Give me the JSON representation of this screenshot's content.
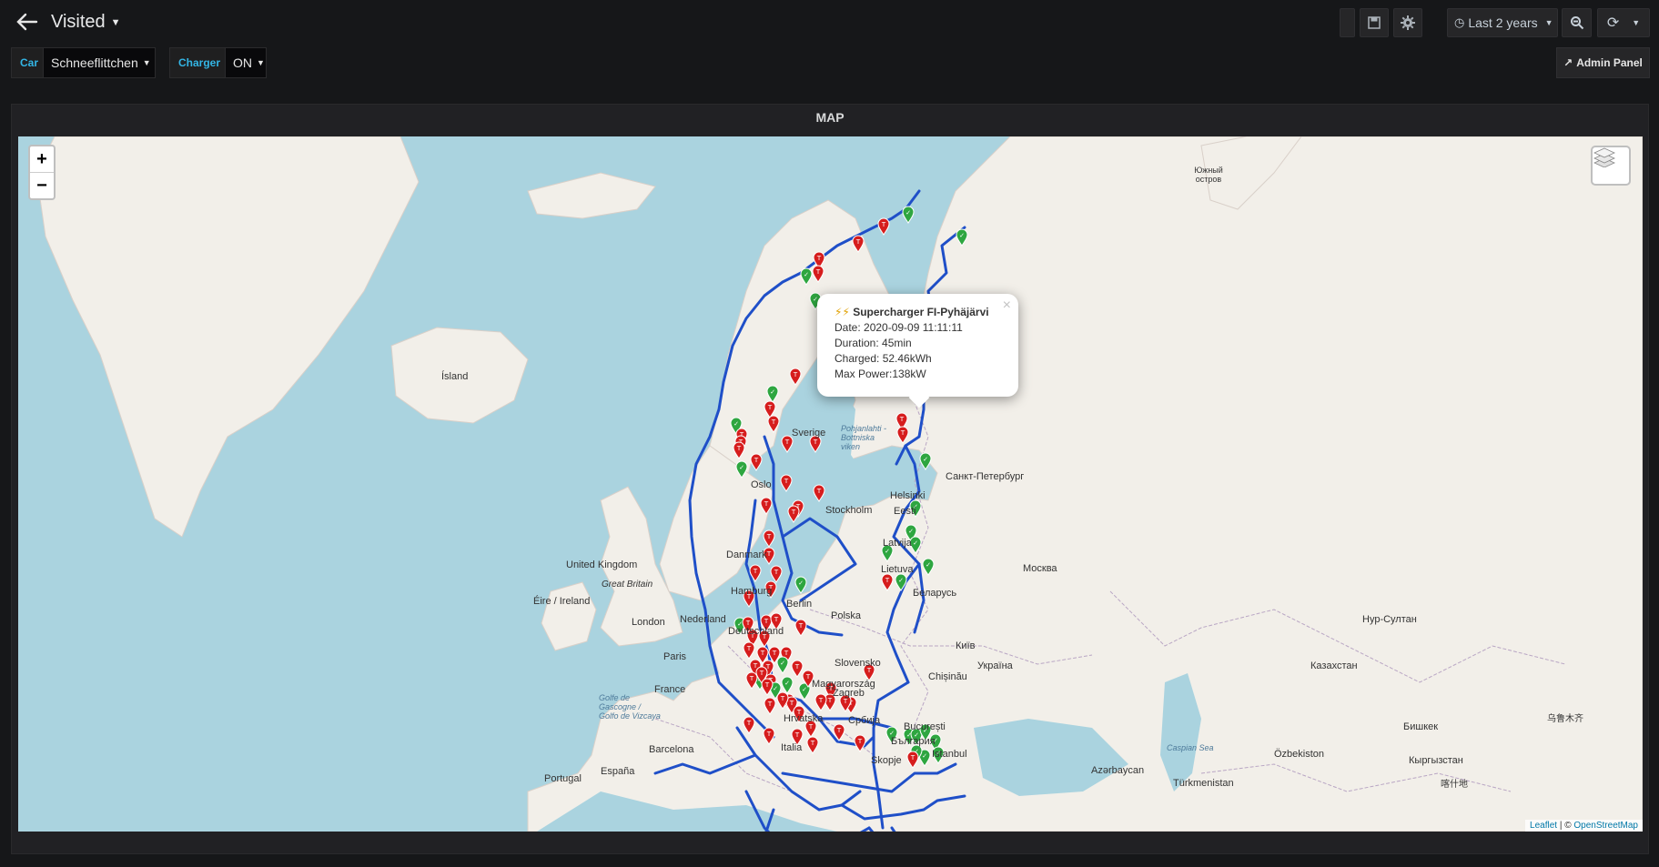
{
  "header": {
    "title": "Visited",
    "time_range": "Last 2 years"
  },
  "variables": [
    {
      "label": "Car",
      "value": "Schneeflittchen"
    },
    {
      "label": "Charger",
      "value": "ON"
    }
  ],
  "admin_panel_label": "Admin Panel",
  "panel": {
    "title": "MAP"
  },
  "map": {
    "zoom_in": "+",
    "zoom_out": "−",
    "popup": {
      "icon": "⚡⚡",
      "title": "Supercharger FI-Pyhäjärvi",
      "date": "Date: 2020-09-09 11:11:11",
      "duration": "Duration: 45min",
      "charged": "Charged: 52.46kWh",
      "max_power": "Max Power:138kW",
      "close": "×"
    },
    "attribution": {
      "leaflet": "Leaflet",
      "separator": " | © ",
      "osm": "OpenStreetMap"
    },
    "place_labels": [
      "Ísland",
      "United Kingdom",
      "Great Britain",
      "Éire / Ireland",
      "London",
      "Nederland",
      "Paris",
      "France",
      "Sverige",
      "Oslo",
      "Stockholm",
      "Danmark",
      "Hamburg",
      "Berlin",
      "Polska",
      "Latvija",
      "Lietuva",
      "Беларусь",
      "Helsinki",
      "Eesti",
      "Санкт-Петербург",
      "Москва",
      "Україна",
      "Київ",
      "Chișinău",
      "Magyarország",
      "Slovensko",
      "Hrvatska",
      "Србија",
      "București",
      "България",
      "Italia",
      "Barcelona",
      "España",
      "Portugal",
      "Istanbul",
      "Казахстан",
      "Нур-Султан",
      "Бишкек",
      "Кыргызстан",
      "Özbekiston",
      "Azərbaycan",
      "Türkmenistan",
      "Южный остров",
      "Pohjanlahti - Bottniska viken",
      "Golfe de Gascogne / Golfo de Vizcaya",
      "Caspian Sea",
      "乌鲁木齐",
      "喀什地",
      "Zagreb",
      "Skopje",
      "Deutschland"
    ],
    "colors": {
      "route": "#1f4fc8",
      "tesla_pin": "#d61d1d",
      "other_pin": "#2ea640",
      "water": "#aad3df",
      "land": "#f2efe9"
    }
  }
}
